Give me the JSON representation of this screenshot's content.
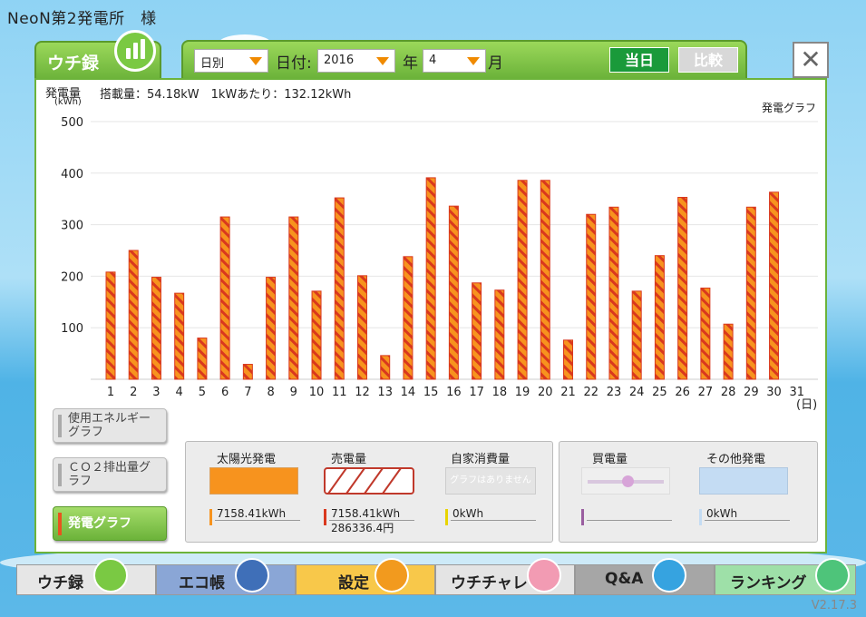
{
  "app": {
    "title": "NeoN第2発電所　様",
    "version": "V2.17.3"
  },
  "tab": {
    "label": "ウチ録",
    "icon": "bar-chart-icon"
  },
  "toolbar": {
    "period_value": "日別",
    "date_label": "日付:",
    "year_value": "2016",
    "year_unit": "年",
    "month_value": "4",
    "month_unit": "月",
    "today_label": "当日",
    "compare_label": "比較"
  },
  "close": {
    "label": "✕"
  },
  "header": {
    "title": "発電量",
    "unit": "(kWh)",
    "capacity": "搭載量：54.18kW　1kWあたり：132.12kWh",
    "graph_name": "発電グラフ"
  },
  "side_buttons": [
    {
      "label": "使用エネルギーグラフ"
    },
    {
      "label": "ＣＯ２排出量グラフ"
    },
    {
      "label": "発電グラフ"
    }
  ],
  "legend": {
    "solar": {
      "title": "太陽光発電",
      "value": "7158.41kWh"
    },
    "sold": {
      "title": "売電量",
      "value": "7158.41kWh",
      "amount": "286336.4円"
    },
    "self": {
      "title": "自家消費量",
      "note": "グラフはありません",
      "value": "0kWh"
    },
    "bought": {
      "title": "買電量"
    },
    "other": {
      "title": "その他発電",
      "value": "0kWh"
    }
  },
  "nav": [
    {
      "label": "ウチ録",
      "icon": "bar-chart-icon"
    },
    {
      "label": "エコ帳",
      "icon": "notebook-icon"
    },
    {
      "label": "設定",
      "icon": "wrench-icon"
    },
    {
      "label": "ウチチャレ",
      "icon": "flag-icon"
    },
    {
      "label": "Q&A",
      "icon": "question-icon"
    },
    {
      "label": "ランキング",
      "icon": "crown-icon"
    }
  ],
  "colors": {
    "bar_fill": "#f7931e",
    "bar_stripe": "#d9381e",
    "accent_green": "#6cb33a"
  },
  "chart_data": {
    "type": "bar",
    "categories": [
      "1",
      "2",
      "3",
      "4",
      "5",
      "6",
      "7",
      "8",
      "9",
      "10",
      "11",
      "12",
      "13",
      "14",
      "15",
      "16",
      "17",
      "18",
      "19",
      "20",
      "21",
      "22",
      "23",
      "24",
      "25",
      "26",
      "27",
      "28",
      "29",
      "30",
      "31"
    ],
    "values": [
      208,
      250,
      198,
      167,
      80,
      315,
      29,
      198,
      315,
      171,
      352,
      201,
      46,
      238,
      391,
      336,
      187,
      173,
      386,
      386,
      76,
      320,
      334,
      171,
      240,
      353,
      177,
      107,
      334,
      363,
      null
    ],
    "ylim": [
      0,
      500
    ],
    "yticks": [
      100,
      200,
      300,
      400,
      500
    ],
    "xunit": "(日)",
    "grid": true
  }
}
